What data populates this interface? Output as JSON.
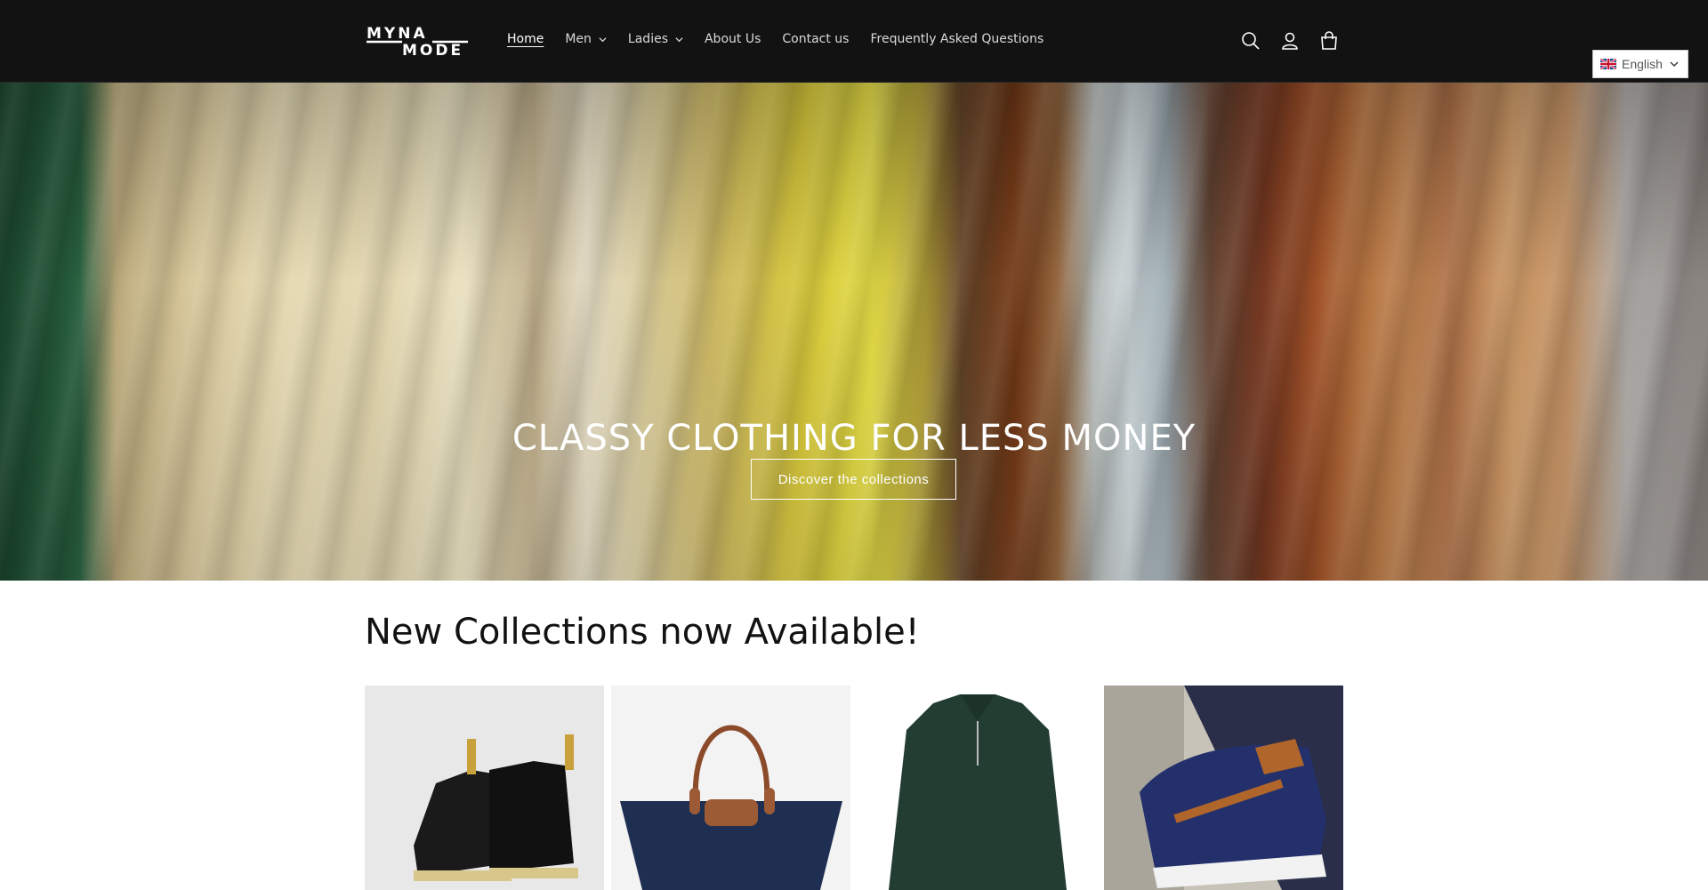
{
  "header": {
    "logo_top": "MYNA",
    "logo_bottom": "MODE",
    "nav": [
      {
        "label": "Home",
        "active": true,
        "dropdown": false
      },
      {
        "label": "Men",
        "active": false,
        "dropdown": true
      },
      {
        "label": "Ladies",
        "active": false,
        "dropdown": true
      },
      {
        "label": "About Us",
        "active": false,
        "dropdown": false
      },
      {
        "label": "Contact us",
        "active": false,
        "dropdown": false
      },
      {
        "label": "Frequently Asked Questions",
        "active": false,
        "dropdown": false
      }
    ],
    "icons": [
      "search-icon",
      "account-icon",
      "cart-icon"
    ]
  },
  "language": {
    "selected": "English",
    "flag": "uk-flag-icon"
  },
  "hero": {
    "title": "CLASSY CLOTHING FOR LESS MONEY",
    "button": "Discover the collections"
  },
  "collections": {
    "title": "New Collections now Available!",
    "products": [
      {
        "name": "black-boots"
      },
      {
        "name": "navy-tote-bag"
      },
      {
        "name": "green-zip-sweater"
      },
      {
        "name": "navy-sneaker"
      }
    ]
  },
  "colors": {
    "header_bg": "#121212",
    "accent_white": "#ffffff"
  }
}
